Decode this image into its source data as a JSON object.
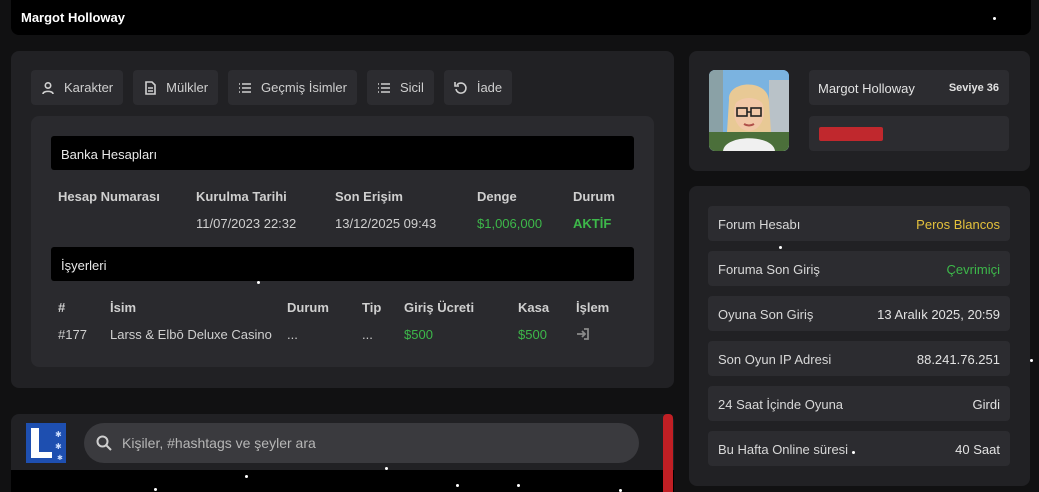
{
  "window": {
    "title": "Margot Holloway"
  },
  "tabs": [
    {
      "label": "Karakter",
      "icon": "user-icon"
    },
    {
      "label": "Mülkler",
      "icon": "document-icon"
    },
    {
      "label": "Geçmiş İsimler",
      "icon": "list-icon"
    },
    {
      "label": "Sicil",
      "icon": "list-icon"
    },
    {
      "label": "İade",
      "icon": "refresh-icon"
    }
  ],
  "bank": {
    "section_title": "Banka Hesapları",
    "headers": [
      "Hesap Numarası",
      "Kurulma Tarihi",
      "Son Erişim",
      "Denge",
      "Durum"
    ],
    "rows": [
      {
        "account": "",
        "created": "11/07/2023 22:32",
        "last_access": "13/12/2025 09:43",
        "balance": "$1,006,000",
        "status": "AKTİF"
      }
    ]
  },
  "business": {
    "section_title": "İşyerleri",
    "headers": [
      "#",
      "İsim",
      "Durum",
      "Tip",
      "Giriş Ücreti",
      "Kasa",
      "İşlem"
    ],
    "rows": [
      {
        "id": "#177",
        "name": "Larss & Elbō Deluxe Casino",
        "status": "...",
        "type": "...",
        "entry_fee": "$500",
        "cash": "$500",
        "action_icon": "login-icon"
      }
    ]
  },
  "profile": {
    "name": "Margot Holloway",
    "level": "Seviye 36",
    "status_bar_color": "#c0282d"
  },
  "info": [
    {
      "label": "Forum Hesabı",
      "value": "Peros Blancos",
      "color": "#e4c13c"
    },
    {
      "label": "Foruma Son Giriş",
      "value": "Çevrimiçi",
      "color": "#3db84a"
    },
    {
      "label": "Oyuna Son Giriş",
      "value": "13 Aralık 2025, 20:59"
    },
    {
      "label": "Son Oyun IP Adresi",
      "value": "88.241.76.251"
    },
    {
      "label": "24 Saat İçinde Oyuna",
      "value": "Girdi"
    },
    {
      "label": "Bu Hafta Online süresi",
      "value": "40 Saat"
    }
  ],
  "phone": {
    "search_placeholder": "Kişiler, #hashtags ve şeyler ara",
    "logo_icon": "app-logo-icon"
  },
  "colors": {
    "accent_green": "#3db84a",
    "accent_yellow": "#e4c13c",
    "accent_red": "#c0282d"
  }
}
